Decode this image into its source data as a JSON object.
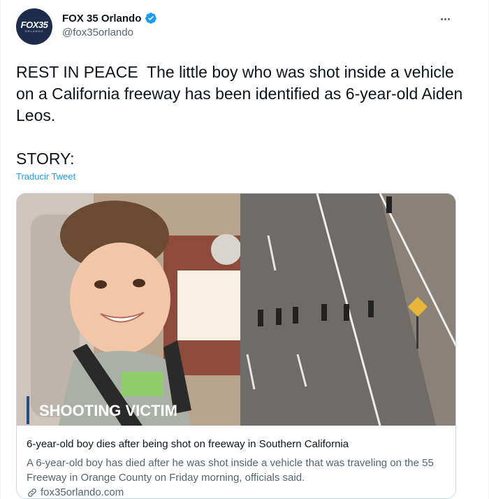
{
  "author": {
    "display_name": "FOX 35 Orlando",
    "handle": "@fox35orlando",
    "verified": true,
    "avatar_logo": "FOX35",
    "avatar_sub": "ORLANDO"
  },
  "tweet": {
    "text": "REST IN PEACE  The little boy who was shot inside a vehicle on a California freeway has been identified as 6-year-old Aiden Leos.\n\nSTORY:",
    "translate_label": "Traducir Tweet"
  },
  "card": {
    "image_overlay_text": "SHOOTING VICTIM",
    "title": "6-year-old boy dies after being shot on freeway in Southern California",
    "description": "A 6-year-old boy has died after he was shot inside a vehicle that was traveling on the 55 Freeway in Orange County on Friday morning, officials said.",
    "domain": "fox35orlando.com"
  },
  "icons": {
    "verified": "verified-badge-icon",
    "more": "more-options-icon",
    "link": "link-icon"
  },
  "colors": {
    "accent": "#1d9bf0",
    "secondary_text": "#536471",
    "avatar_bg": "#1d2c4a",
    "overlay_bar": "#2b4a8a"
  }
}
